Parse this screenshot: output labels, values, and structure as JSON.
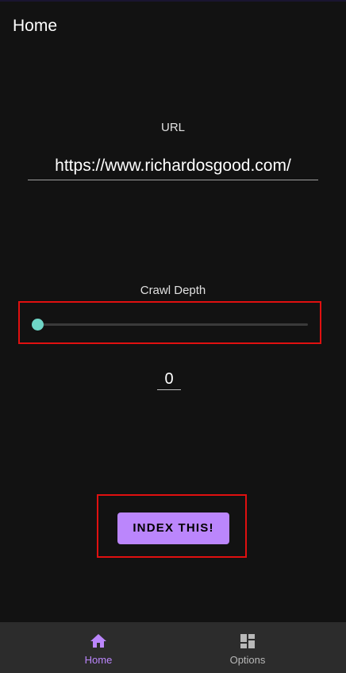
{
  "header": {
    "title": "Home"
  },
  "url_section": {
    "label": "URL",
    "value": "https://www.richardosgood.com/"
  },
  "depth_section": {
    "label": "Crawl Depth",
    "slider_value": 0,
    "value_text": "0"
  },
  "action": {
    "button_label": "INDEX THIS!"
  },
  "bottom_nav": {
    "items": [
      {
        "label": "Home",
        "icon": "home-icon",
        "active": true
      },
      {
        "label": "Options",
        "icon": "dashboard-icon",
        "active": false
      }
    ]
  },
  "colors": {
    "background": "#121212",
    "accent": "#bb86fc",
    "slider_thumb": "#6fd5c6",
    "highlight": "#e01010"
  }
}
